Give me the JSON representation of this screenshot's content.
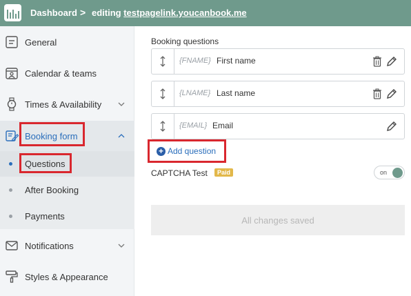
{
  "topbar": {
    "dashboard_label": "Dashboard",
    "separator": ">",
    "editing_prefix": "editing ",
    "editing_link": "testpagelink.youcanbook.me",
    "bg_color": "#6f9a8c"
  },
  "sidebar": {
    "items": [
      {
        "label": "General",
        "icon": "general-icon"
      },
      {
        "label": "Calendar & teams",
        "icon": "calendar-teams-icon"
      },
      {
        "label": "Times & Availability",
        "icon": "watch-icon"
      },
      {
        "label": "Booking form",
        "icon": "form-edit-icon"
      },
      {
        "label": "Notifications",
        "icon": "envelope-icon"
      },
      {
        "label": "Styles & Appearance",
        "icon": "paint-roller-icon"
      }
    ],
    "subitems": [
      {
        "label": "Questions"
      },
      {
        "label": "After Booking"
      },
      {
        "label": "Payments"
      }
    ]
  },
  "main": {
    "section_title": "Booking questions",
    "questions": [
      {
        "token": "{FNAME}",
        "label": "First name"
      },
      {
        "token": "{LNAME}",
        "label": "Last name"
      },
      {
        "token": "{EMAIL}",
        "label": "Email"
      }
    ],
    "add_question_label": "Add question",
    "captcha_label": "CAPTCHA Test",
    "paid_badge": "Paid",
    "toggle_label": "on",
    "saved_status": "All changes saved"
  },
  "colors": {
    "accent_blue": "#2a6ebb",
    "highlight_red": "#d9272e",
    "paid_gold": "#e2b84a"
  }
}
